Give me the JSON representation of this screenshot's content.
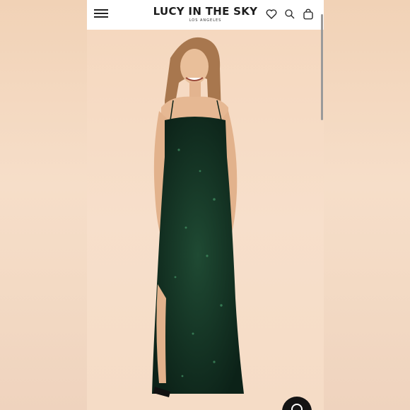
{
  "header": {
    "brand_name": "LUCY IN THE SKY",
    "brand_location": "LOS ANGELES",
    "icons": [
      "menu-icon",
      "heart-icon",
      "search-icon",
      "shopping-bag-icon"
    ]
  },
  "product_image": {
    "subject": "model in green sequin maxi dress",
    "dress_color": "#0e2a1c",
    "background_color": "#f5d9c2"
  },
  "chat": {
    "icon": "chat-icon"
  }
}
